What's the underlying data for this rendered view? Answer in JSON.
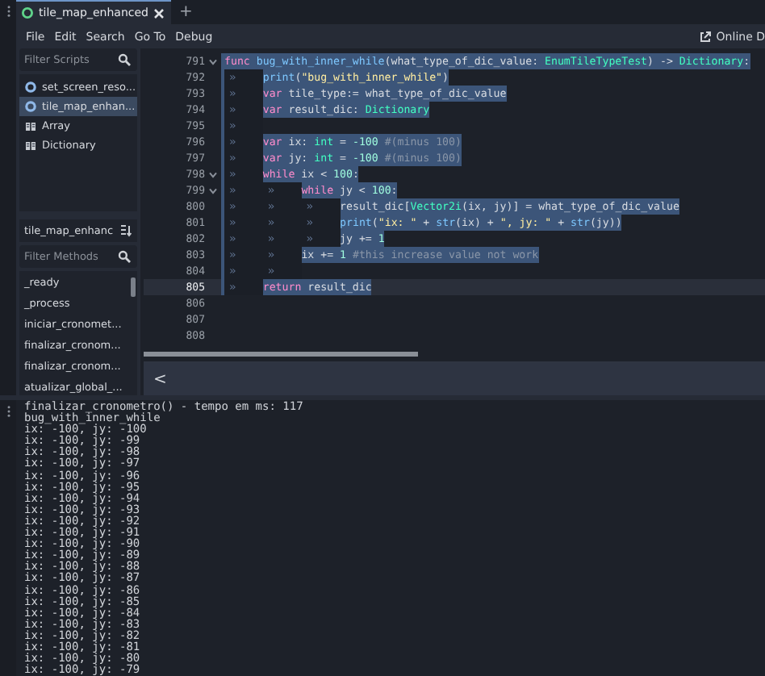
{
  "tabs": [
    {
      "label": "tile_map_enhanced",
      "selected": true
    }
  ],
  "new_tab": "+",
  "menu": [
    "File",
    "Edit",
    "Search",
    "Go To",
    "Debug"
  ],
  "online_docs": "Online D",
  "scripts_filter": {
    "placeholder": "Filter Scripts"
  },
  "scripts": [
    {
      "label": "set_screen_reso...",
      "kind": "script",
      "selected": false
    },
    {
      "label": "tile_map_enhan...",
      "kind": "script",
      "selected": true
    },
    {
      "label": "Array",
      "kind": "class",
      "selected": false
    },
    {
      "label": "Dictionary",
      "kind": "class",
      "selected": false
    }
  ],
  "methods_header": "tile_map_enhanc",
  "methods_filter": {
    "placeholder": "Filter Methods"
  },
  "methods": [
    "_ready",
    "_process",
    "iniciar_cronomet...",
    "finalizar_cronom...",
    "finalizar_cronom...",
    "atualizar_global_..."
  ],
  "code_lines": [
    {
      "number": "791",
      "fold": true,
      "selected": true,
      "current": false,
      "tokens": [
        {
          "kind": "keyword",
          "text": "func "
        },
        {
          "kind": "func",
          "text": "bug_with_inner_while"
        },
        {
          "kind": "name",
          "text": "(what_type_of_dic_value: "
        },
        {
          "kind": "type",
          "text": "EnumTileTypeTest"
        },
        {
          "kind": "name",
          "text": ") -> "
        },
        {
          "kind": "type",
          "text": "Dictionary"
        },
        {
          "kind": "name",
          "text": ":"
        }
      ]
    },
    {
      "number": "792",
      "fold": false,
      "selected": true,
      "current": false,
      "tokens": [
        {
          "kind": "tab",
          "text": "»"
        },
        {
          "kind": "func",
          "text": "print"
        },
        {
          "kind": "name",
          "text": "("
        },
        {
          "kind": "string",
          "text": "\"bug_with_inner_while\""
        },
        {
          "kind": "name",
          "text": ")"
        }
      ]
    },
    {
      "number": "793",
      "fold": false,
      "selected": true,
      "current": false,
      "tokens": [
        {
          "kind": "tab",
          "text": "»"
        },
        {
          "kind": "keyword",
          "text": "var "
        },
        {
          "kind": "name",
          "text": "tile_type:= what_type_of_dic_value"
        }
      ]
    },
    {
      "number": "794",
      "fold": false,
      "selected": true,
      "current": false,
      "tokens": [
        {
          "kind": "tab",
          "text": "»"
        },
        {
          "kind": "keyword",
          "text": "var "
        },
        {
          "kind": "name",
          "text": "result_dic: "
        },
        {
          "kind": "type",
          "text": "Dictionary"
        }
      ]
    },
    {
      "number": "795",
      "fold": false,
      "selected": true,
      "current": false,
      "tokens": [
        {
          "kind": "tab",
          "text": "»"
        }
      ]
    },
    {
      "number": "796",
      "fold": false,
      "selected": true,
      "current": false,
      "tokens": [
        {
          "kind": "tab",
          "text": "»"
        },
        {
          "kind": "keyword",
          "text": "var "
        },
        {
          "kind": "name",
          "text": "ix: "
        },
        {
          "kind": "type",
          "text": "int"
        },
        {
          "kind": "name",
          "text": " = "
        },
        {
          "kind": "number",
          "text": "-100"
        },
        {
          "kind": "comment",
          "text": " #(minus 100)"
        }
      ]
    },
    {
      "number": "797",
      "fold": false,
      "selected": true,
      "current": false,
      "tokens": [
        {
          "kind": "tab",
          "text": "»"
        },
        {
          "kind": "keyword",
          "text": "var "
        },
        {
          "kind": "name",
          "text": "jy: "
        },
        {
          "kind": "type",
          "text": "int"
        },
        {
          "kind": "name",
          "text": " = "
        },
        {
          "kind": "number",
          "text": "-100"
        },
        {
          "kind": "comment",
          "text": " #(minus 100)"
        }
      ]
    },
    {
      "number": "798",
      "fold": true,
      "selected": true,
      "current": false,
      "tokens": [
        {
          "kind": "tab",
          "text": "»"
        },
        {
          "kind": "keyword",
          "text": "while "
        },
        {
          "kind": "name",
          "text": "ix < "
        },
        {
          "kind": "number",
          "text": "100"
        },
        {
          "kind": "name",
          "text": ":"
        }
      ]
    },
    {
      "number": "799",
      "fold": true,
      "selected": true,
      "current": false,
      "tokens": [
        {
          "kind": "tab",
          "text": "»"
        },
        {
          "kind": "tab",
          "text": "»"
        },
        {
          "kind": "keyword",
          "text": "while "
        },
        {
          "kind": "name",
          "text": "jy < "
        },
        {
          "kind": "number",
          "text": "100"
        },
        {
          "kind": "name",
          "text": ":"
        }
      ]
    },
    {
      "number": "800",
      "fold": false,
      "selected": true,
      "current": false,
      "tokens": [
        {
          "kind": "tab",
          "text": "»"
        },
        {
          "kind": "tab",
          "text": "»"
        },
        {
          "kind": "tab",
          "text": "»"
        },
        {
          "kind": "name",
          "text": "result_dic["
        },
        {
          "kind": "type",
          "text": "Vector2i"
        },
        {
          "kind": "name",
          "text": "(ix, jy)] = what_type_of_dic_value"
        }
      ]
    },
    {
      "number": "801",
      "fold": false,
      "selected": true,
      "current": false,
      "tokens": [
        {
          "kind": "tab",
          "text": "»"
        },
        {
          "kind": "tab",
          "text": "»"
        },
        {
          "kind": "tab",
          "text": "»"
        },
        {
          "kind": "func",
          "text": "print"
        },
        {
          "kind": "name",
          "text": "("
        },
        {
          "kind": "string",
          "text": "\"ix: \""
        },
        {
          "kind": "name",
          "text": " + "
        },
        {
          "kind": "func",
          "text": "str"
        },
        {
          "kind": "name",
          "text": "(ix) + "
        },
        {
          "kind": "string",
          "text": "\", jy: \""
        },
        {
          "kind": "name",
          "text": " + "
        },
        {
          "kind": "func",
          "text": "str"
        },
        {
          "kind": "name",
          "text": "(jy))"
        }
      ]
    },
    {
      "number": "802",
      "fold": false,
      "selected": true,
      "current": false,
      "tokens": [
        {
          "kind": "tab",
          "text": "»"
        },
        {
          "kind": "tab",
          "text": "»"
        },
        {
          "kind": "tab",
          "text": "»"
        },
        {
          "kind": "name",
          "text": "jy += "
        },
        {
          "kind": "number",
          "text": "1"
        }
      ]
    },
    {
      "number": "803",
      "fold": false,
      "selected": true,
      "current": false,
      "tokens": [
        {
          "kind": "tab",
          "text": "»"
        },
        {
          "kind": "tab",
          "text": "»"
        },
        {
          "kind": "name",
          "text": "ix += "
        },
        {
          "kind": "number",
          "text": "1"
        },
        {
          "kind": "comment",
          "text": " #this increase value not work"
        }
      ]
    },
    {
      "number": "804",
      "fold": false,
      "selected": true,
      "current": false,
      "tokens": [
        {
          "kind": "tab",
          "text": "»"
        },
        {
          "kind": "tab",
          "text": "»"
        }
      ]
    },
    {
      "number": "805",
      "fold": false,
      "selected": true,
      "current": true,
      "tokens": [
        {
          "kind": "tab",
          "text": "»"
        },
        {
          "kind": "keyword",
          "text": "return "
        },
        {
          "kind": "name",
          "text": "result_dic"
        }
      ]
    },
    {
      "number": "806",
      "fold": false,
      "selected": false,
      "current": false
    },
    {
      "number": "807",
      "fold": false,
      "selected": false,
      "current": false
    },
    {
      "number": "808",
      "fold": false,
      "selected": false,
      "current": false
    }
  ],
  "collapse_button": "<",
  "output_lines": [
    "finalizar_cronometro() - tempo em ms: 117",
    "bug_with_inner_while",
    "ix: -100, jy: -100",
    "ix: -100, jy: -99",
    "ix: -100, jy: -98",
    "ix: -100, jy: -97",
    "ix: -100, jy: -96",
    "ix: -100, jy: -95",
    "ix: -100, jy: -94",
    "ix: -100, jy: -93",
    "ix: -100, jy: -92",
    "ix: -100, jy: -91",
    "ix: -100, jy: -90",
    "ix: -100, jy: -89",
    "ix: -100, jy: -88",
    "ix: -100, jy: -87",
    "ix: -100, jy: -86",
    "ix: -100, jy: -85",
    "ix: -100, jy: -84",
    "ix: -100, jy: -83",
    "ix: -100, jy: -82",
    "ix: -100, jy: -81",
    "ix: -100, jy: -80",
    "ix: -100, jy: -79"
  ]
}
